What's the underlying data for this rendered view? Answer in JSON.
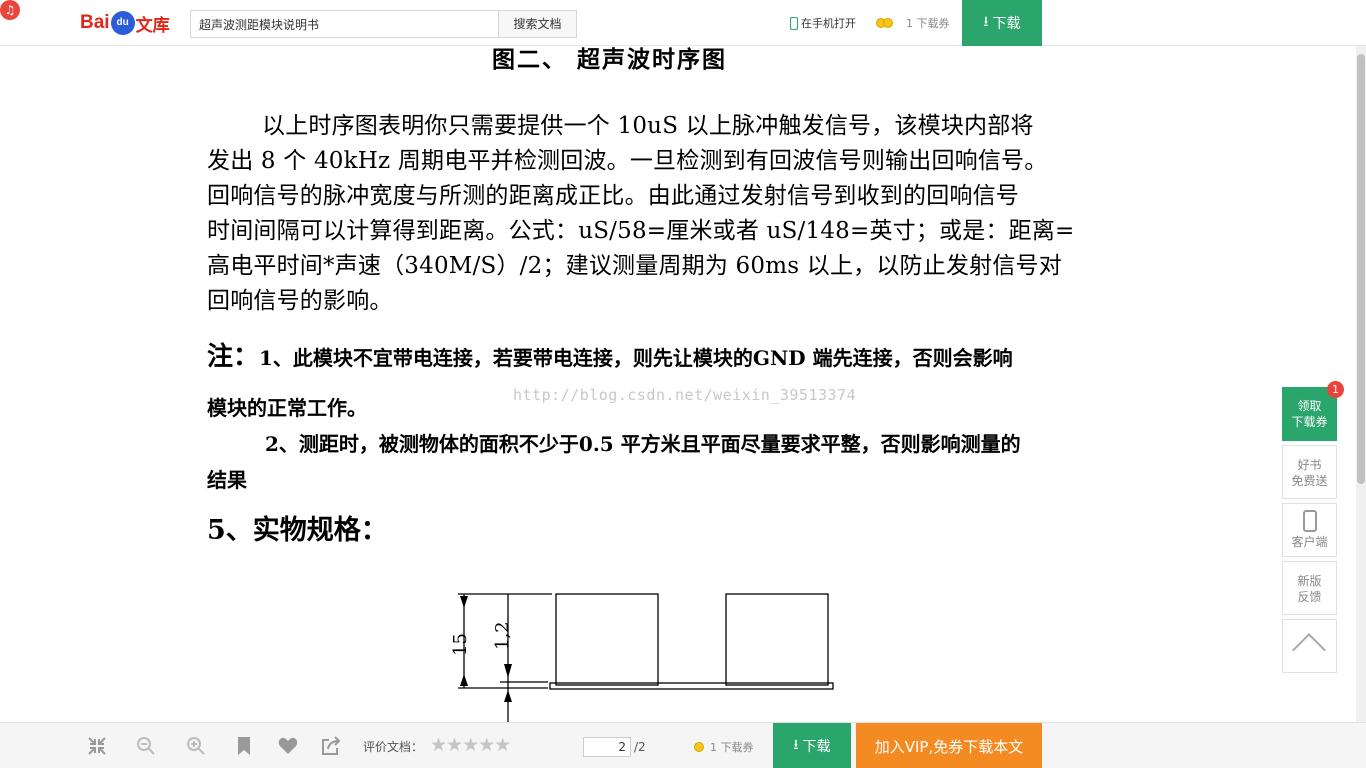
{
  "header": {
    "corner_icon": "netease-music-icon",
    "logo_bai": "Bai",
    "logo_du": "du",
    "logo_wenku": "文库",
    "search_value": "超声波测距模块说明书",
    "search_button": "搜索文档",
    "open_mobile": "在手机打开",
    "coupon_text": "1 下载券",
    "download_label": "下载"
  },
  "document": {
    "figure_title": "图二、 超声波时序图",
    "paragraph": [
      "以上时序图表明你只需要提供一个 10uS 以上脉冲触发信号，该模块内部将",
      "发出 8 个 40kHz 周期电平并检测回波。一旦检测到有回波信号则输出回响信号。",
      "回响信号的脉冲宽度与所测的距离成正比。由此通过发射信号到收到的回响信号",
      "时间间隔可以计算得到距离。公式：uS/58=厘米或者 uS/148=英寸；或是：距离=",
      "高电平时间*声速（340M/S）/2；建议测量周期为 60ms 以上，以防止发射信号对",
      "回响信号的影响。"
    ],
    "note_prefix": "注：",
    "note1_line1": "1、此模块不宜带电连接，若要带电连接，则先让模块的GND 端先连接，否则会影响",
    "note1_line2": "模块的正常工作。",
    "note2_line1": "2、测距时，被测物体的面积不少于0.5 平方米且平面尽量要求平整，否则影响测量的",
    "note2_line2": "结果",
    "section_title": "5、实物规格：",
    "watermark": "http://blog.csdn.net/weixin_39513374",
    "dim_15": "15",
    "dim_12": "1,2"
  },
  "sidebar": {
    "coupon_line1": "领取",
    "coupon_line2": "下载券",
    "coupon_badge": "1",
    "book_line1": "好书",
    "book_line2": "免费送",
    "client_label": "客户端",
    "feedback_line1": "新版",
    "feedback_line2": "反馈"
  },
  "footer": {
    "rate_label": "评价文档：",
    "stars": "★★★★★",
    "page_current": "2",
    "page_total": "/2",
    "coupon_text": "1 下载券",
    "download_label": "下载",
    "vip_label": "加入VIP,免券下载本文"
  }
}
